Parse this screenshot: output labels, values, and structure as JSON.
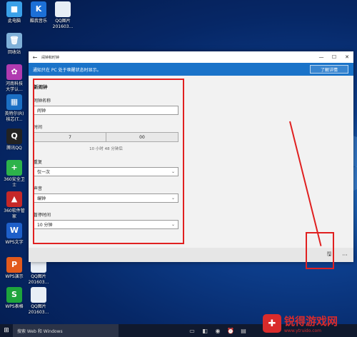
{
  "desktop": {
    "icons": [
      {
        "label": "此电脑",
        "glyph": "■",
        "color": "#3aa0e8"
      },
      {
        "label": "酷我音乐",
        "glyph": "K",
        "color": "#1c6fd6"
      },
      {
        "label": "QQ图片\n201603...",
        "glyph": "",
        "color": "#e8eef5"
      },
      {
        "label": "回收站",
        "glyph": "🗑",
        "color": "#7fb0d8"
      },
      {
        "label": "河南科技\n大学认...",
        "glyph": "✿",
        "color": "#b03bb0"
      },
      {
        "label": "英特尔(R)\n核芯(T...",
        "glyph": "▦",
        "color": "#1b6fc4"
      },
      {
        "label": "腾讯QQ",
        "glyph": "Q",
        "color": "#222222"
      },
      {
        "label": "360安全卫\n士",
        "glyph": "+",
        "color": "#2db34a"
      },
      {
        "label": "360软件管\n家",
        "glyph": "▲",
        "color": "#c62828"
      },
      {
        "label": "WPS文字",
        "glyph": "W",
        "color": "#1e5fc9"
      },
      {
        "label": "WPS演示",
        "glyph": "P",
        "color": "#e25a1c"
      },
      {
        "label": "QQ图片\n201603...",
        "glyph": "",
        "color": "#e8eef5"
      },
      {
        "label": "WPS表格",
        "glyph": "S",
        "color": "#1ea43c"
      },
      {
        "label": "QQ图片\n201603...",
        "glyph": "",
        "color": "#e8eef5"
      }
    ]
  },
  "window": {
    "title": "闹钟和时钟",
    "notice": "通知只在 PC 处于唤醒状态时显示。",
    "learn_more": "了解详情",
    "heading": "新闹钟",
    "name_label": "闹钟名称",
    "name_value": "闹钟",
    "time_label": "时间",
    "hour": "7",
    "minute": "00",
    "remaining": "10 小时 48 分钟后",
    "repeat_label": "重复",
    "repeat_value": "仅一次",
    "sound_label": "声音",
    "sound_value": "编钟",
    "snooze_label": "暂停时间",
    "snooze_value": "10 分钟"
  },
  "taskbar": {
    "search_placeholder": "搜索 Web 和 Windows"
  },
  "watermark": {
    "name": "锐得游戏网",
    "url": "www.ytruido.com"
  },
  "colors": {
    "accent": "#1a73c9",
    "annotation": "#e02020"
  }
}
